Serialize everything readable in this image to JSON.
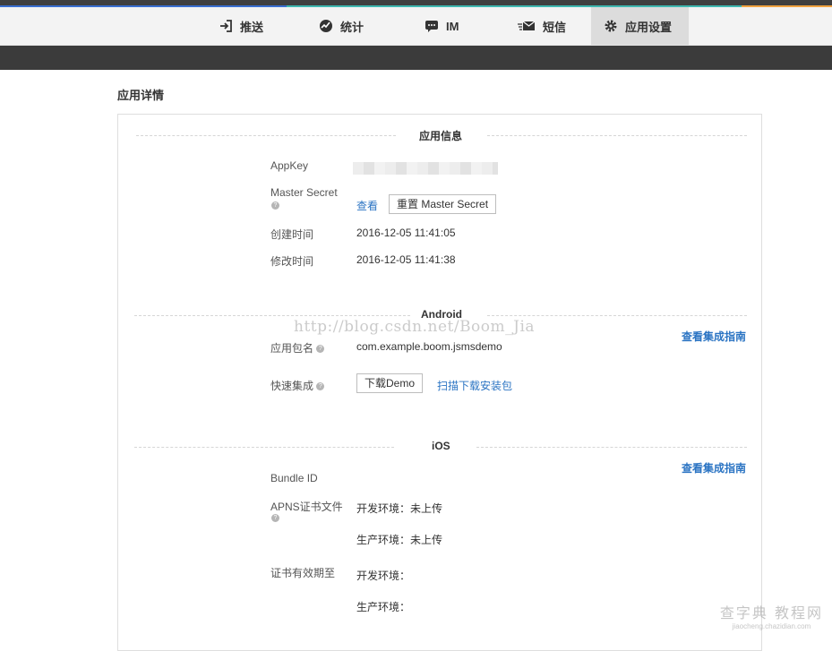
{
  "colors": {
    "accent_blue": "#3a6fd1",
    "accent_teal": "#3fb8b0",
    "accent_orange": "#f0a341",
    "link": "#2b74c3"
  },
  "nav": {
    "items": [
      {
        "label": "推送",
        "icon": "push-icon"
      },
      {
        "label": "统计",
        "icon": "stats-icon"
      },
      {
        "label": "IM",
        "icon": "chat-icon"
      },
      {
        "label": "短信",
        "icon": "sms-icon"
      },
      {
        "label": "应用设置",
        "icon": "gear-icon",
        "active": true
      }
    ]
  },
  "page": {
    "title": "应用详情"
  },
  "app_info": {
    "heading": "应用信息",
    "appkey_label": "AppKey",
    "master_secret_label": "Master Secret",
    "view_link": "查看",
    "reset_button": "重置 Master Secret",
    "created_label": "创建时间",
    "created_value": "2016-12-05 11:41:05",
    "modified_label": "修改时间",
    "modified_value": "2016-12-05 11:41:38"
  },
  "android": {
    "heading": "Android",
    "guide_link": "查看集成指南",
    "package_label": "应用包名",
    "package_value": "com.example.boom.jsmsdemo",
    "quick_label": "快速集成",
    "download_button": "下载Demo",
    "scan_link": "扫描下载安装包"
  },
  "ios": {
    "heading": "iOS",
    "guide_link": "查看集成指南",
    "bundle_label": "Bundle ID",
    "apns_label": "APNS证书文件",
    "apns_dev": "开发环境：未上传",
    "apns_prod": "生产环境：未上传",
    "validity_label": "证书有效期至",
    "validity_dev": "开发环境：",
    "validity_prod": "生产环境："
  },
  "help_glyph": "?",
  "watermark": "http://blog.csdn.net/Boom_Jia",
  "corner_mark": {
    "main": "查字典 教程网",
    "sub": "jiaocheng.chazidian.com"
  }
}
